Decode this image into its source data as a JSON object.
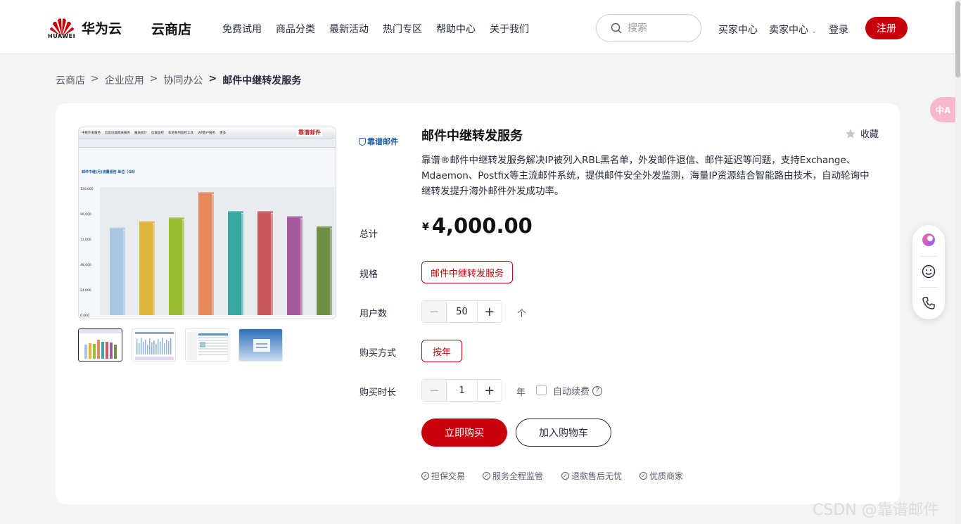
{
  "header": {
    "logo_text": "HUAWEI",
    "brand": "华为云",
    "store": "云商店",
    "nav": [
      "免费试用",
      "商品分类",
      "最新活动",
      "热门专区",
      "帮助中心",
      "关于我们"
    ],
    "search_placeholder": "搜索",
    "buyer_center": "买家中心",
    "seller_center": "卖家中心",
    "login": "登录",
    "register": "注册"
  },
  "breadcrumb": [
    "云商店",
    "企业应用",
    "协同办公",
    "邮件中继转发服务"
  ],
  "breadcrumb_sep": ">",
  "product": {
    "vendor_logo_text": "靠谱邮件",
    "title": "邮件中继转发服务",
    "favorite": "收藏",
    "description": "靠谱®邮件中继转发服务解决IP被列入RBL黑名单，外发邮件退信、邮件延迟等问题，支持Exchange、Mdaemon、Postfix等主流邮件系统，提供邮件安全外发监测，海量IP资源结合智能路由技术，自动轮询中继转发提升海外邮件外发成功率。",
    "total_label": "总计",
    "currency": "¥",
    "price": "4,000.00",
    "spec_label": "规格",
    "spec_value": "邮件中继转发服务",
    "users_label": "用户数",
    "users_value": "50",
    "users_unit": "个",
    "mode_label": "购买方式",
    "mode_value": "按年",
    "duration_label": "购买时长",
    "duration_value": "1",
    "duration_unit": "年",
    "auto_renew": "自动续费",
    "buy_now": "立即购买",
    "add_cart": "加入购物车",
    "guarantees": [
      "担保交易",
      "服务全程监管",
      "退款售后无忧",
      "优质商家"
    ]
  },
  "screenshot": {
    "tabs": [
      "中继外发服务",
      "云反垃圾网关服务",
      "报表统计",
      "信誉监控",
      "本地系列监控工具",
      "VIP客户服务",
      "更多"
    ],
    "chart_title": "邮件中继(月)流量报告 单位（GB）",
    "y_ticks": [
      "120,000",
      "96,000",
      "72,000",
      "48,000",
      "24,000",
      "0.000"
    ],
    "bar_colors": [
      "#a9c6e2",
      "#e0b43a",
      "#9bbb33",
      "#e6895a",
      "#3aa6a0",
      "#c9595e",
      "#a25a9a",
      "#6f8f46"
    ]
  },
  "float_bar": [
    "assistant-icon",
    "smile-icon",
    "phone-icon"
  ],
  "translate_badge": "中A",
  "watermark": "CSDN @靠谱邮件"
}
